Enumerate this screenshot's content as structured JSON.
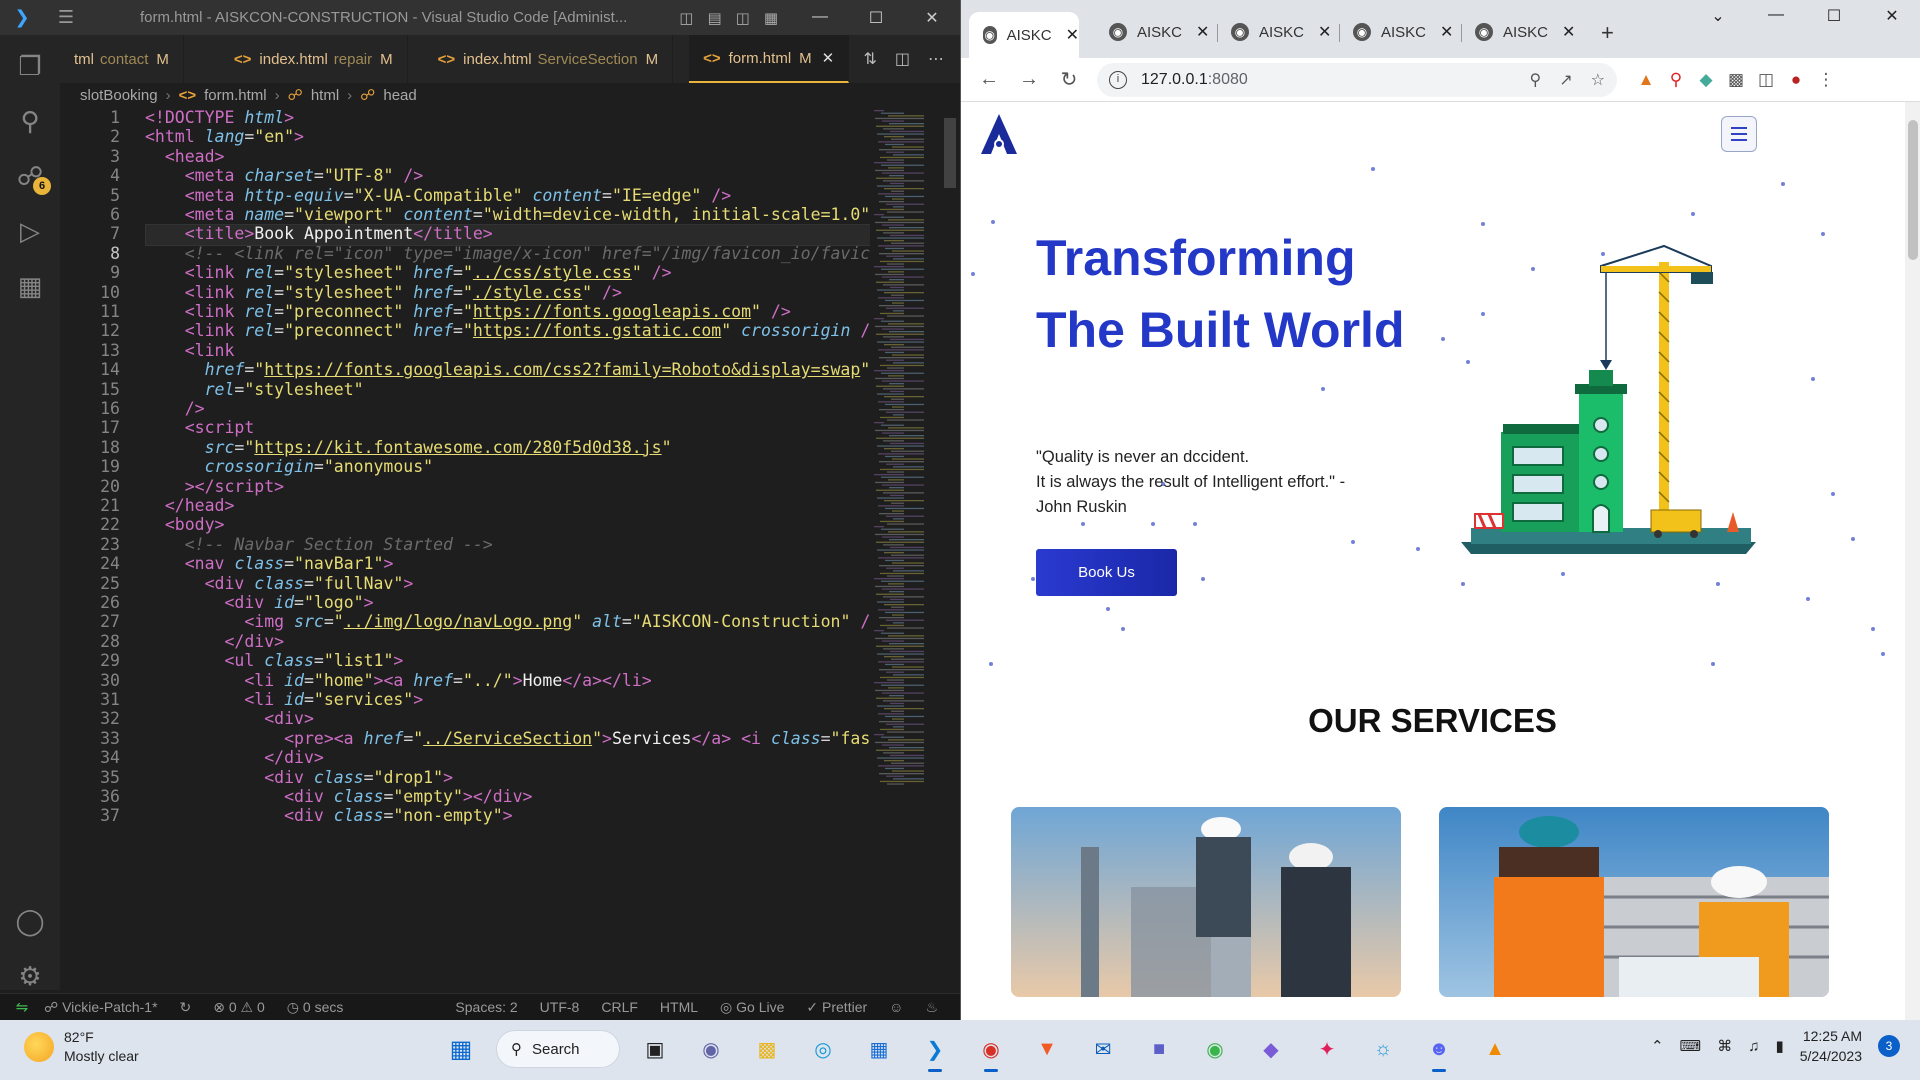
{
  "vscode": {
    "title": "form.html - AISKCON-CONSTRUCTION - Visual Studio Code [Administ...",
    "tabs": [
      {
        "name": "tml",
        "sub": "contact",
        "mod": "M"
      },
      {
        "name": "index.html",
        "sub": "repair",
        "mod": "M"
      },
      {
        "name": "index.html",
        "sub": "ServiceSection",
        "mod": "M"
      },
      {
        "name": "form.html",
        "sub": "",
        "mod": "M"
      }
    ],
    "breadcrumb": [
      "slotBooking",
      "form.html",
      "html",
      "head"
    ],
    "scm_badge": "6",
    "lines": [
      "1",
      "2",
      "3",
      "4",
      "5",
      "6",
      "7",
      "8",
      "9",
      "10",
      "11",
      "12",
      "13",
      "14",
      "15",
      "16",
      "17",
      "18",
      "19",
      "20",
      "21",
      "22",
      "23",
      "24",
      "25",
      "26",
      "27",
      "28",
      "29",
      "30",
      "31",
      "32",
      "33",
      "34",
      "35",
      "36",
      "37"
    ],
    "status": {
      "branch": "Vickie-Patch-1*",
      "problems": "⊗ 0 ⚠ 0",
      "timer": "0 secs",
      "spaces": "Spaces: 2",
      "encoding": "UTF-8",
      "eol": "CRLF",
      "language": "HTML",
      "golive": "Go Live",
      "prettier": "Prettier"
    }
  },
  "chrome": {
    "tabs": [
      "AISKC",
      "AISKC",
      "AISKC",
      "AISKC",
      "AISKC"
    ],
    "url_host": "127.0.0.1",
    "url_port": ":8080"
  },
  "site": {
    "hero_title": "Transforming The Built World",
    "quote_line1": "\"Quality is never an dccident.",
    "quote_line2": "It is always the result of Intelligent effort.\" -",
    "quote_line3": "John Ruskin",
    "cta": "Book Us",
    "services_heading": "OUR SERVICES"
  },
  "taskbar": {
    "temp": "82°F",
    "weather": "Mostly clear",
    "search": "Search",
    "time": "12:25 AM",
    "date": "5/24/2023",
    "notif": "3"
  }
}
